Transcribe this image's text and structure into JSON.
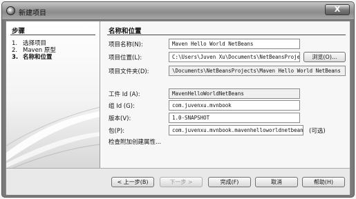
{
  "window": {
    "title": "新建项目",
    "close_label": "X"
  },
  "steps": {
    "heading": "步骤",
    "items": [
      {
        "num": "1.",
        "label": "选择项目"
      },
      {
        "num": "2.",
        "label": "Maven 原型"
      },
      {
        "num": "3.",
        "label": "名称和位置"
      }
    ]
  },
  "main": {
    "heading": "名称和位置",
    "fields": {
      "project_name": {
        "label": "项目名称(N):",
        "value": "Maven Hello World NetBeans"
      },
      "project_location": {
        "label": "项目位置(L):",
        "value": "C:\\Users\\Juven Xu\\Documents\\NetBeansProjects"
      },
      "project_folder": {
        "label": "项目文件夹(D):",
        "value": "\\Documents\\NetBeansProjects\\Maven Hello World NetBeans"
      },
      "artifact_id": {
        "label": "工件 Id (A):",
        "value": "MavenHelloWorldNetBeans"
      },
      "group_id": {
        "label": "组 Id (G):",
        "value": "com.juvenxu.mvnbook"
      },
      "version": {
        "label": "版本(V):",
        "value": "1.0-SNAPSHOT"
      },
      "package": {
        "label": "包(P):",
        "value": "com.juvenxu.mvnbook.mavenhelloworldnetbeans"
      }
    },
    "browse_label": "浏览(O)...",
    "optional_label": "(可选)",
    "more_props_label": "检查附加创建属性..."
  },
  "footer": {
    "back": "< 上一步(B)",
    "next": "下一步 >",
    "finish": "完成(F)",
    "cancel": "取消",
    "help": "帮助(H)"
  }
}
